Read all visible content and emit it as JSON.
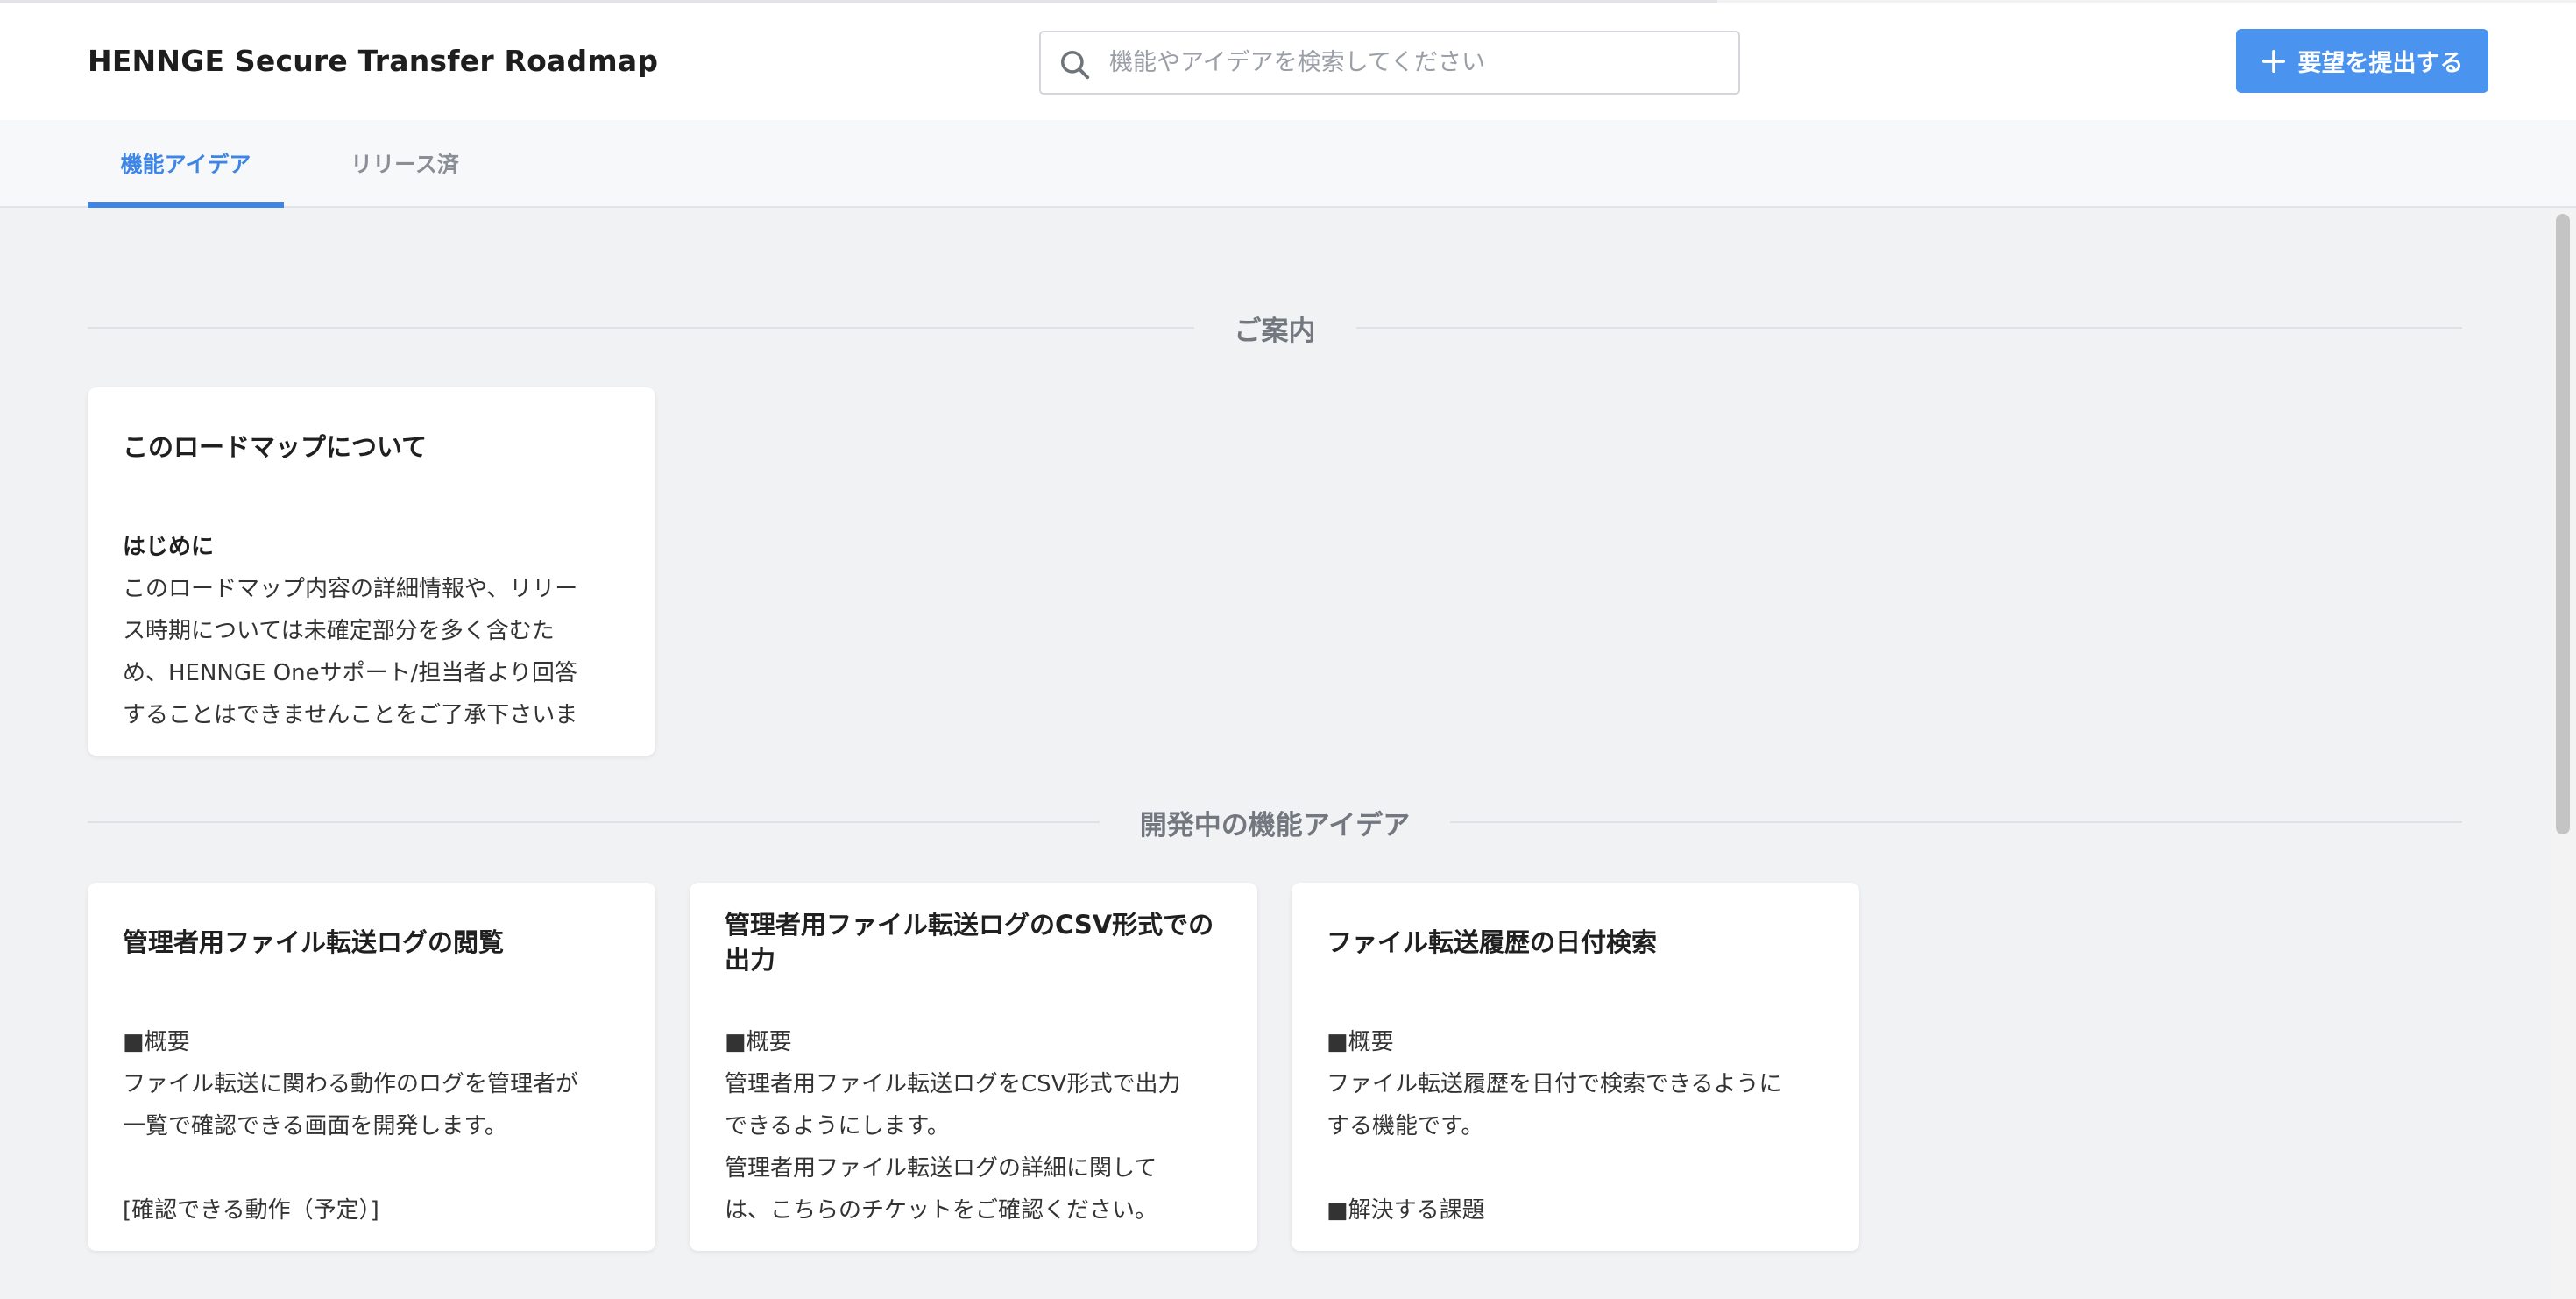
{
  "header": {
    "title": "HENNGE Secure Transfer Roadmap",
    "search_placeholder": "機能やアイデアを検索してください",
    "submit_label": "要望を提出する"
  },
  "tabs": [
    {
      "label": "機能アイデア",
      "active": true
    },
    {
      "label": "リリース済",
      "active": false
    }
  ],
  "sections": [
    {
      "title": "ご案内",
      "cards": [
        {
          "title": "このロードマップについて",
          "heading": "はじめに",
          "lines": [
            "このロードマップ内容の詳細情報や、リリー",
            "ス時期については未確定部分を多く含むた",
            "め、HENNGE Oneサポート/担当者より回答",
            "することはできませんことをご了承下さいま"
          ]
        }
      ]
    },
    {
      "title": "開発中の機能アイデア",
      "cards": [
        {
          "title": "管理者用ファイル転送ログの閲覧",
          "lines": [
            "■概要",
            "ファイル転送に関わる動作のログを管理者が",
            "一覧で確認できる画面を開発します。",
            "",
            "[確認できる動作（予定）]"
          ]
        },
        {
          "title": "管理者用ファイル転送ログのCSV形式での出力",
          "lines": [
            "■概要",
            "管理者用ファイル転送ログをCSV形式で出力",
            "できるようにします。",
            "管理者用ファイル転送ログの詳細に関して",
            "は、こちらのチケットをご確認ください。"
          ]
        },
        {
          "title": "ファイル転送履歴の日付検索",
          "lines": [
            "■概要",
            "ファイル転送履歴を日付で検索できるように",
            "する機能です。",
            "",
            "■解決する課題"
          ]
        }
      ]
    }
  ],
  "colors": {
    "accent": "#4a94f0",
    "tab_active": "#3d86e6",
    "background": "#f1f2f4"
  },
  "icons": {
    "search": "search-icon",
    "plus": "plus-icon"
  }
}
